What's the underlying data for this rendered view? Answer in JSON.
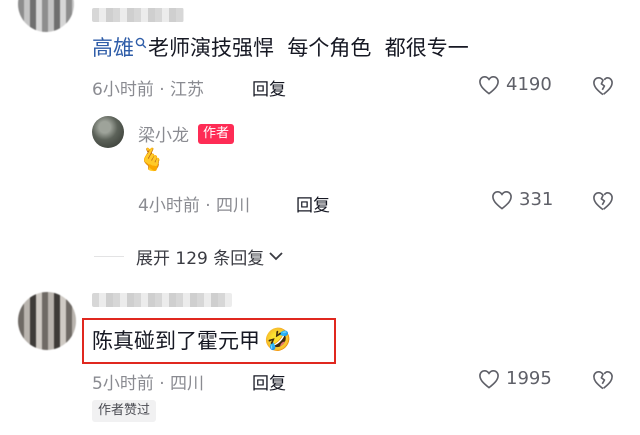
{
  "comment1": {
    "username": "高雄",
    "text": "老师演技强悍  每个角色  都很专一",
    "time_location": "6小时前 · 江苏",
    "reply_label": "回复",
    "likes": "4190"
  },
  "author_reply": {
    "username": "梁小龙",
    "author_tag": "作者",
    "emoji": "🫰",
    "time_location": "4小时前 · 四川",
    "reply_label": "回复",
    "likes": "331"
  },
  "expand": {
    "label": "展开 129 条回复"
  },
  "comment2": {
    "text": "陈真碰到了霍元甲",
    "emoji": "🤣",
    "time_location": "5小时前 · 四川",
    "reply_label": "回复",
    "likes": "1995",
    "author_liked_tag": "作者赞过"
  },
  "colors": {
    "highlight_border": "#e0281f",
    "username_blue": "#2f5da8",
    "author_tag_bg": "#fe2c55"
  },
  "icons": [
    "search-icon",
    "heart-outline-icon",
    "broken-heart-icon",
    "chevron-down-icon"
  ]
}
